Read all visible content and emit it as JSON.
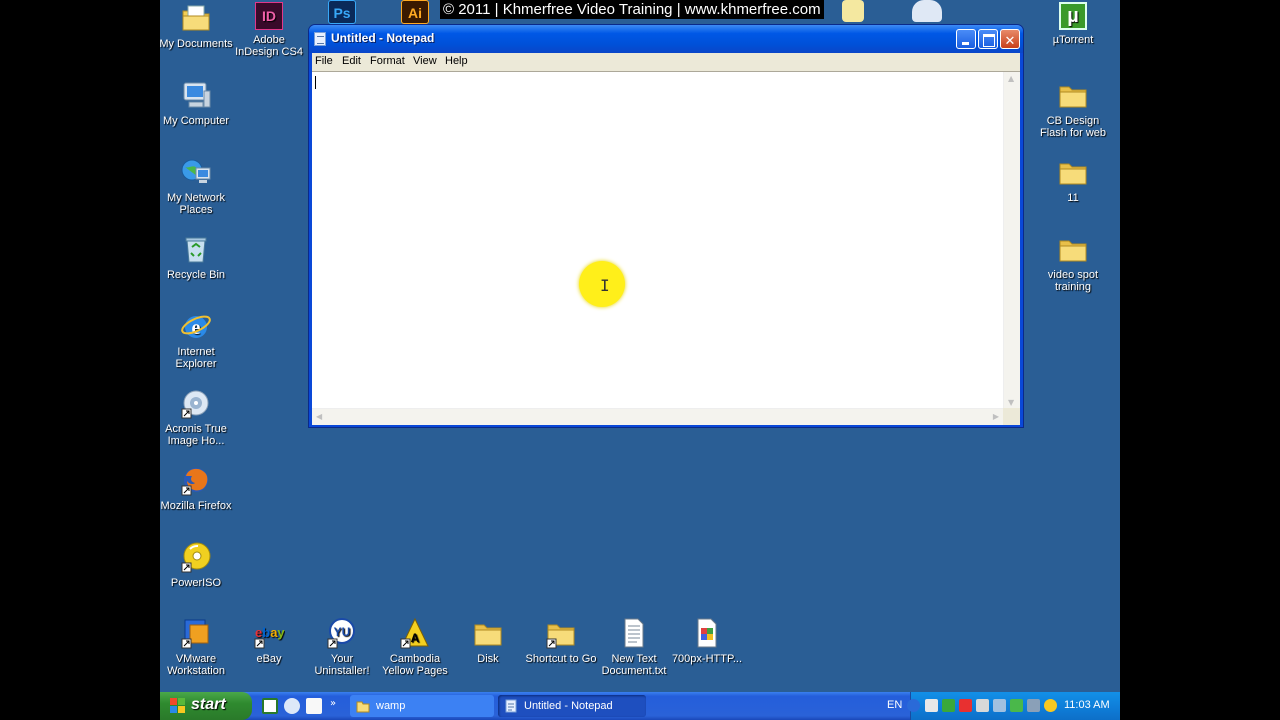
{
  "watermark": "© 2011 | Khmerfree Video Training | www.khmerfree.com",
  "desktop": {
    "left_icons": [
      {
        "label": "My Documents",
        "icon": "my-documents-icon"
      },
      {
        "label": "My Computer",
        "icon": "my-computer-icon"
      },
      {
        "label": "My Network Places",
        "icon": "network-places-icon"
      },
      {
        "label": "Recycle Bin",
        "icon": "recycle-bin-icon"
      },
      {
        "label": "Internet Explorer",
        "icon": "internet-explorer-icon"
      },
      {
        "label": "Acronis True Image Ho...",
        "icon": "acronis-icon"
      },
      {
        "label": "Mozilla Firefox",
        "icon": "firefox-icon"
      },
      {
        "label": "PowerISO",
        "icon": "poweriso-icon"
      }
    ],
    "indesign": {
      "label": "Adobe InDesign CS4",
      "glyph": "ID"
    },
    "top_partial": [
      {
        "glyph": "Ps",
        "icon": "photoshop-icon"
      },
      {
        "glyph": "Ai",
        "icon": "illustrator-icon"
      }
    ],
    "right_icons": [
      {
        "label": "µTorrent",
        "icon": "utorrent-icon",
        "glyph": "µ"
      },
      {
        "label": "CB Design Flash for web",
        "icon": "folder-icon"
      },
      {
        "label": "11",
        "icon": "folder-icon"
      },
      {
        "label": "video spot training",
        "icon": "folder-icon"
      }
    ],
    "bottom_icons": [
      {
        "label": "VMware Workstation",
        "icon": "vmware-icon"
      },
      {
        "label": "eBay",
        "icon": "ebay-icon"
      },
      {
        "label": "Your Uninstaller!",
        "icon": "uninstaller-icon"
      },
      {
        "label": "Cambodia Yellow Pages",
        "icon": "yellow-pages-icon"
      },
      {
        "label": "Disk",
        "icon": "folder-icon"
      },
      {
        "label": "Shortcut to Go",
        "icon": "folder-icon"
      },
      {
        "label": "New Text Document.txt",
        "icon": "text-document-icon"
      },
      {
        "label": "700px-HTTP...",
        "icon": "image-file-icon"
      }
    ]
  },
  "notepad": {
    "title": "Untitled - Notepad",
    "menu": [
      "File",
      "Edit",
      "Format",
      "View",
      "Help"
    ],
    "content": ""
  },
  "taskbar": {
    "start_label": "start",
    "tasks": [
      {
        "label": "wamp",
        "icon": "folder-icon"
      },
      {
        "label": "Untitled - Notepad",
        "icon": "notepad-icon"
      }
    ],
    "language": "EN",
    "clock": "11:03 AM"
  },
  "colors": {
    "desktop": "#2a5e95",
    "titlebar": "#0058e6",
    "taskbar": "#245edb",
    "start": "#2f8a2f",
    "cursor_highlight": "#ffef1a"
  }
}
